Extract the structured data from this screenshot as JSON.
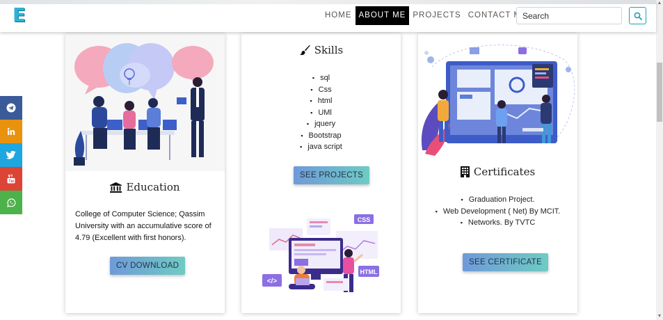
{
  "navbar": {
    "logo": "E",
    "links": [
      {
        "label": "HOME"
      },
      {
        "label": "ABOUT ME"
      },
      {
        "label": "PROJECTS"
      },
      {
        "label": "CONTACT ME"
      }
    ],
    "active_index": 1,
    "search": {
      "placeholder": "Search",
      "value": ""
    },
    "search_icon": "search-icon"
  },
  "social": [
    {
      "name": "telegram",
      "icon": "telegram-icon",
      "color": "#3b5a98"
    },
    {
      "name": "linkedin",
      "icon": "linkedin-icon",
      "color": "#e8920d"
    },
    {
      "name": "twitter",
      "icon": "twitter-icon",
      "color": "#1da6e0"
    },
    {
      "name": "youtube",
      "icon": "youtube-icon",
      "color": "#dc4436"
    },
    {
      "name": "whatsapp",
      "icon": "whatsapp-icon",
      "color": "#4db24a"
    }
  ],
  "education": {
    "title": "Education",
    "icon": "bank-icon",
    "text": "College of Computer Science; Qassim University with an accumulative score of 4.79 (Excellent with first honors).",
    "button": "CV DOWNLOAD"
  },
  "skills": {
    "title": "Skills",
    "icon": "paintbrush-icon",
    "items": [
      "sql",
      "Css",
      "html",
      "UMl",
      "jquery",
      "Bootstrap",
      "java script"
    ],
    "button": "SEE PROJECTS",
    "illustration_labels": {
      "css": "CSS",
      "html": "HTML",
      "code": "</>"
    }
  },
  "certificates": {
    "title": "Certificates",
    "icon": "building-icon",
    "items": [
      "Graduation Project.",
      "Web Development ( Net) By MCIT.",
      "Networks. By TVTC"
    ],
    "button": "SEE CERTIFICATE"
  },
  "colors": {
    "accent": "#17a2b8",
    "button_gradient_start": "#6f9ad9",
    "button_gradient_end": "#6ecbc4",
    "nav_active_bg": "#000000"
  }
}
